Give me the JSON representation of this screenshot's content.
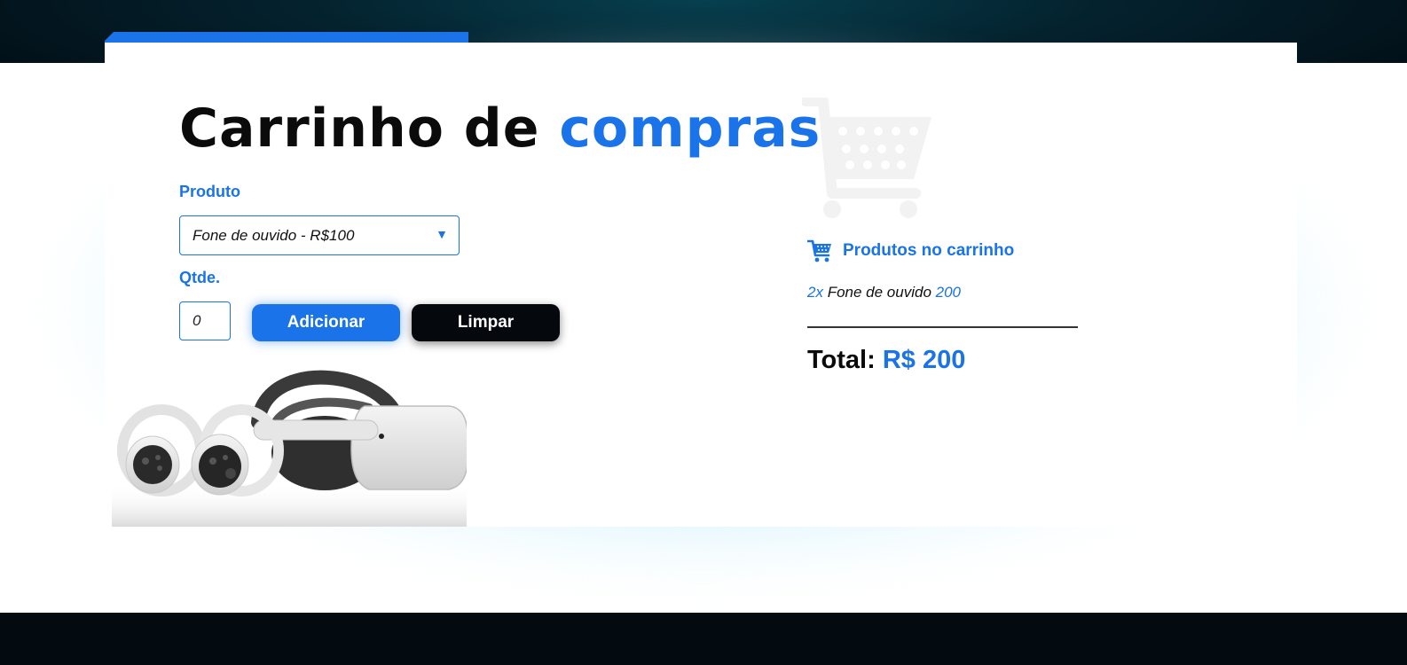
{
  "page": {
    "title_main": "Carrinho de",
    "title_accent": "compras"
  },
  "form": {
    "product_label": "Produto",
    "product_selected": "Fone de ouvido - R$100",
    "qty_label": "Qtde.",
    "qty_value": "0",
    "add_button": "Adicionar",
    "clear_button": "Limpar"
  },
  "cart": {
    "heading": "Produtos no carrinho",
    "items": [
      {
        "qty": "2x",
        "name": "Fone de ouvido",
        "price": "200"
      }
    ],
    "total_label": "Total:",
    "total_value": "R$ 200"
  },
  "icons": {
    "select_arrow": "dropdown-triangle-icon",
    "cart_heading": "shopping-cart-icon",
    "background": "shopping-cart-watermark-icon",
    "product_image": "vr-headset-image"
  },
  "colors": {
    "accent": "#1a73e8",
    "dark": "#05090d",
    "watermark": "#f2f2f2"
  }
}
